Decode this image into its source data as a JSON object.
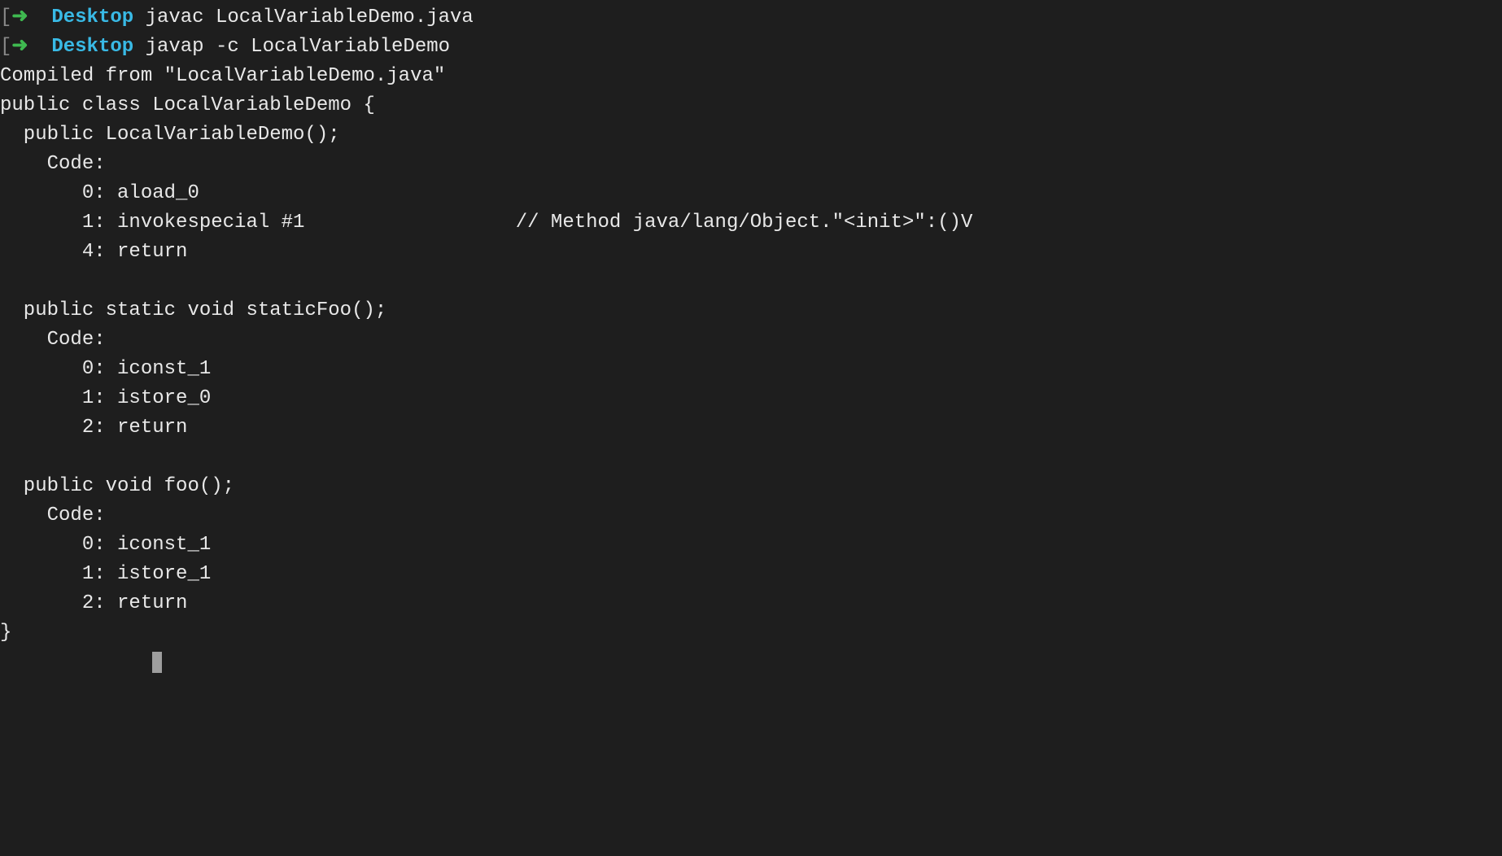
{
  "lines": {
    "0": {
      "bracket": "[",
      "arrow": "➜",
      "space1": "  ",
      "dir": "Desktop",
      "space2": " ",
      "cmd": "javac LocalVariableDemo.java"
    },
    "1": {
      "bracket": "[",
      "arrow": "➜",
      "space1": "  ",
      "dir": "Desktop",
      "space2": " ",
      "cmd": "javap -c LocalVariableDemo"
    },
    "2": "Compiled from \"LocalVariableDemo.java\"",
    "3": "public class LocalVariableDemo {",
    "4": "  public LocalVariableDemo();",
    "5": "    Code:",
    "6": "       0: aload_0",
    "7": "       1: invokespecial #1                  // Method java/lang/Object.\"<init>\":()V",
    "8": "       4: return",
    "9": "",
    "10": "  public static void staticFoo();",
    "11": "    Code:",
    "12": "       0: iconst_1",
    "13": "       1: istore_0",
    "14": "       2: return",
    "15": "",
    "16": "  public void foo();",
    "17": "    Code:",
    "18": "       0: iconst_1",
    "19": "       1: istore_1",
    "20": "       2: return",
    "21": "}",
    "22": "             "
  }
}
